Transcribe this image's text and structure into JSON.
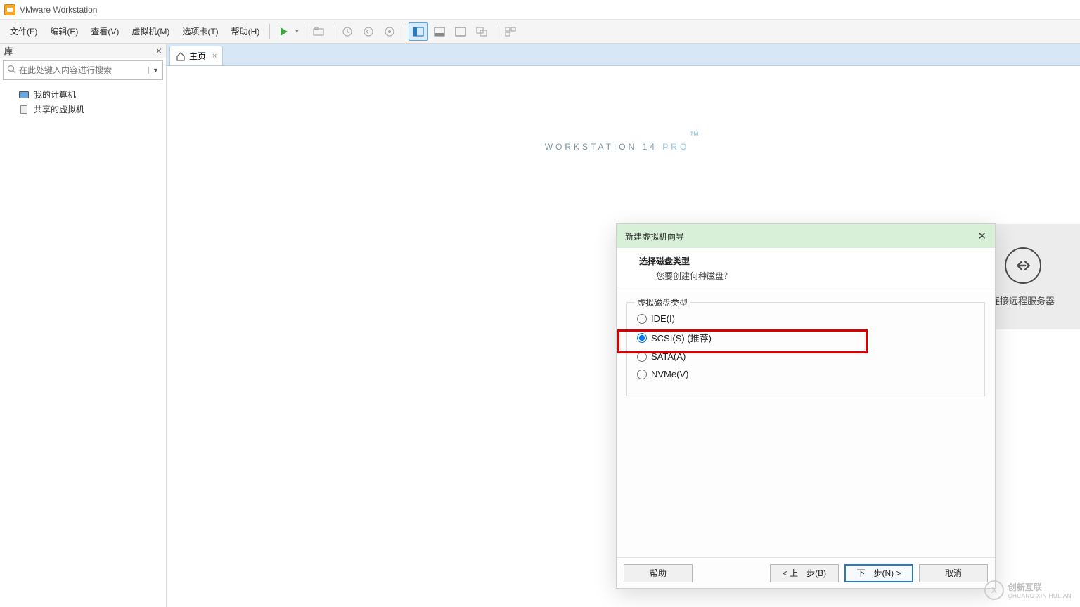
{
  "app": {
    "title": "VMware Workstation"
  },
  "menu": {
    "items": [
      "文件(F)",
      "编辑(E)",
      "查看(V)",
      "虚拟机(M)",
      "选项卡(T)",
      "帮助(H)"
    ]
  },
  "sidebar": {
    "title": "库",
    "search_placeholder": "在此处键入内容进行搜索",
    "tree": [
      {
        "icon": "monitor",
        "label": "我的计算机"
      },
      {
        "icon": "shared",
        "label": "共享的虚拟机"
      }
    ]
  },
  "tabs": [
    {
      "icon": "home",
      "label": "主页"
    }
  ],
  "welcome": {
    "product_line1": "WORKSTATION 14 ",
    "product_pro": "PRO",
    "tm": "™"
  },
  "quicktile": {
    "label": "连接远程服务器"
  },
  "dialog": {
    "title": "新建虚拟机向导",
    "heading": "选择磁盘类型",
    "subheading": "您要创建何种磁盘？",
    "group_label": "虚拟磁盘类型",
    "options": [
      {
        "label": "IDE(I)",
        "checked": false
      },
      {
        "label": "SCSI(S)    (推荐)",
        "checked": true
      },
      {
        "label": "SATA(A)",
        "checked": false
      },
      {
        "label": "NVMe(V)",
        "checked": false
      }
    ],
    "buttons": {
      "help": "帮助",
      "back": "< 上一步(B)",
      "next": "下一步(N) >",
      "cancel": "取消"
    }
  },
  "watermark": {
    "text": "创新互联",
    "sub": "CHUANG XIN HULIAN"
  }
}
